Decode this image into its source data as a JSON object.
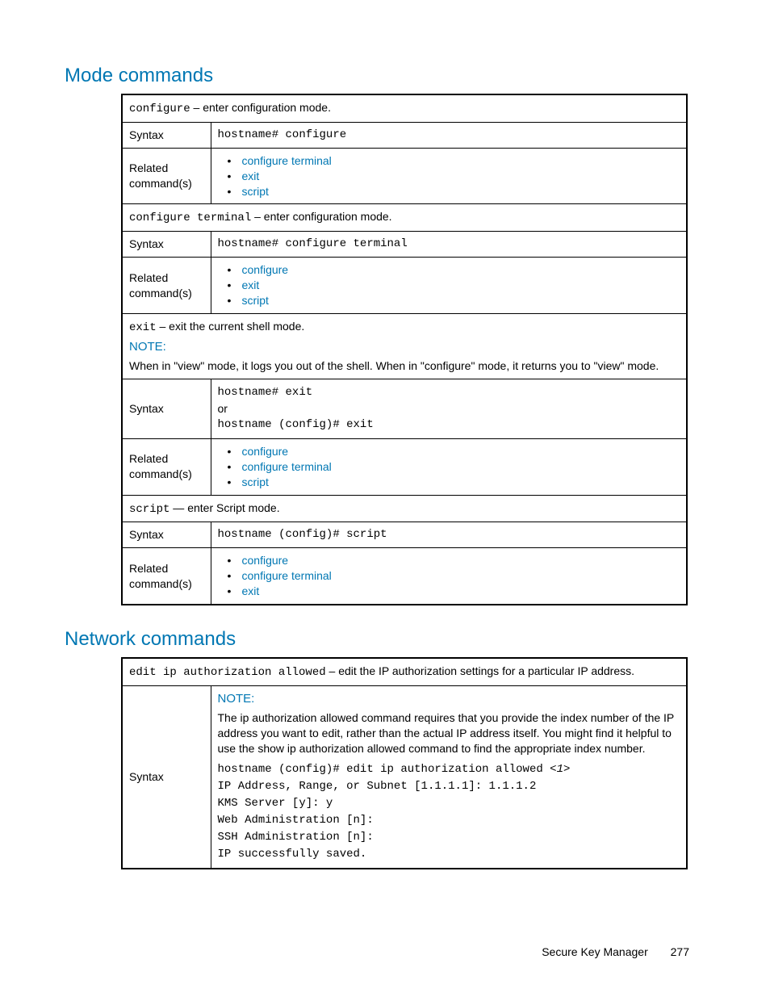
{
  "headings": {
    "mode": "Mode commands",
    "network": "Network commands"
  },
  "labels": {
    "syntax": "Syntax",
    "related": "Related command(s)",
    "note": "NOTE:"
  },
  "mode": {
    "configure": {
      "name": "configure",
      "desc": " – enter configuration mode.",
      "syntax": "hostname# configure",
      "related": [
        "configure terminal",
        "exit",
        "script"
      ]
    },
    "configure_terminal": {
      "name": "configure terminal",
      "desc": " – enter configuration mode.",
      "syntax": "hostname# configure terminal",
      "related": [
        "configure",
        "exit",
        "script"
      ]
    },
    "exit": {
      "name": "exit",
      "desc": " – exit the current shell mode.",
      "note_body": "When in \"view\" mode, it logs you out of the shell.  When in \"configure\" mode, it returns you to \"view\" mode.",
      "syntax1": "hostname# exit",
      "syntax_or": "or",
      "syntax2": "hostname (config)# exit",
      "related": [
        "configure",
        "configure terminal",
        "script"
      ]
    },
    "script": {
      "name": "script",
      "desc": " — enter Script mode.",
      "syntax": "hostname (config)# script",
      "related": [
        "configure",
        "configure terminal",
        "exit"
      ]
    }
  },
  "network": {
    "edit_ip": {
      "name": "edit ip authorization allowed",
      "desc": " – edit the IP authorization settings for a particular IP address.",
      "note_body": "The ip authorization allowed command requires that you provide the index number of the IP address you want to edit, rather than the actual IP address itself. You might find it helpful to use the show ip authorization allowed command to find the appropriate index number.",
      "syntax_lines": {
        "l1a": "hostname (config)# edit ip authorization allowed <",
        "l1num": "1",
        "l1b": ">",
        "l2": "IP Address, Range, or Subnet [1.1.1.1]:  1.1.1.2",
        "l3": "KMS Server [y]:  y",
        "l4": "Web Administration [n]:",
        "l5": "SSH Administration [n]:",
        "l6": "IP successfully saved."
      }
    }
  },
  "footer": {
    "title": "Secure Key Manager",
    "page": "277"
  }
}
